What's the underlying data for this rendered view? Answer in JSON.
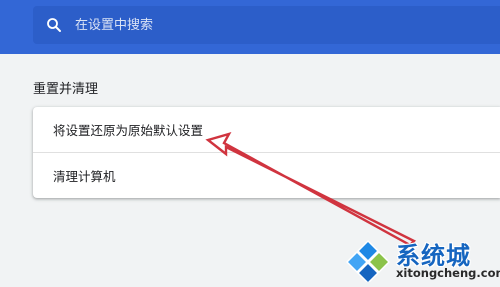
{
  "search": {
    "placeholder": "在设置中搜索"
  },
  "section": {
    "title": "重置并清理"
  },
  "options": [
    {
      "label": "将设置还原为原始默认设置"
    },
    {
      "label": "清理计算机"
    }
  ],
  "watermark": {
    "name": "系统城",
    "url": "xitongcheng.com"
  },
  "colors": {
    "header": "#3367d6",
    "search_field": "#2c5ec9",
    "page_background": "#f1f3f4",
    "annotation_arrow": "#d0343f",
    "watermark_blue": "#1565c0",
    "watermark_green": "#8bc34a"
  },
  "icons": {
    "search": "search-icon",
    "annotation": "arrow-annotation-icon",
    "logo": "windows-logo-icon"
  }
}
